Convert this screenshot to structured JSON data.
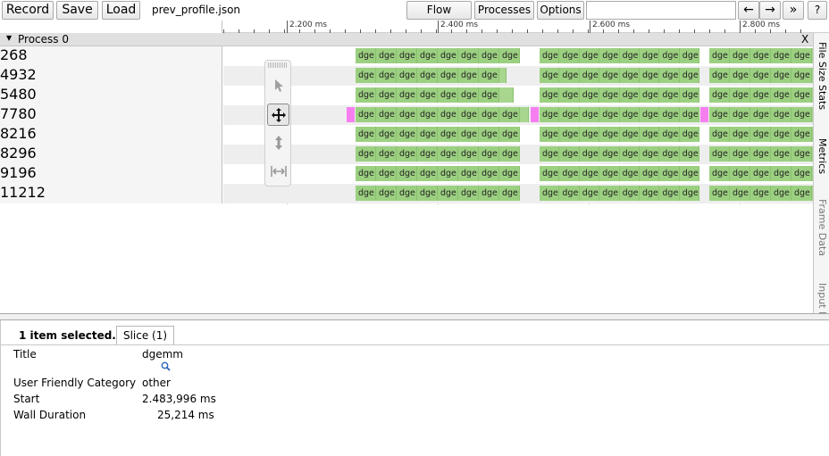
{
  "toolbar": {
    "record_label": "Record",
    "save_label": "Save",
    "load_label": "Load",
    "filename": "prev_profile.json",
    "flow_events_label": "Flow events",
    "processes_label": "Processes",
    "options_label": "Options",
    "search_value": "",
    "prev_label": "←",
    "next_label": "→",
    "forward_all_label": "»",
    "help_label": "?"
  },
  "ruler": {
    "labels": [
      "2.200 ms",
      "2.400 ms",
      "2.600 ms",
      "2.800 ms"
    ]
  },
  "process": {
    "title": "Process 0",
    "close_label": "X"
  },
  "threads": [
    {
      "tid": "268"
    },
    {
      "tid": "4932"
    },
    {
      "tid": "5480"
    },
    {
      "tid": "7780"
    },
    {
      "tid": "8216"
    },
    {
      "tid": "8296"
    },
    {
      "tid": "9196"
    },
    {
      "tid": "11212"
    }
  ],
  "slice_label": "dge",
  "slice_label_clipped": "dge d",
  "side_tabs": [
    "File Size Stats",
    "Metrics",
    "Frame Data",
    "Input L"
  ],
  "analysis": {
    "selection_text": "1 item selected.",
    "tab_label": "Slice (1)",
    "properties": [
      {
        "label": "Title",
        "value": "dgemm"
      },
      {
        "label": "User Friendly Category",
        "value": "other"
      },
      {
        "label": "Start",
        "value": "2.483,996 ms"
      },
      {
        "label": "Wall Duration",
        "value": "25,214 ms"
      }
    ]
  },
  "icons": [
    "pointer-icon",
    "pan-icon",
    "zoom-icon",
    "timing-icon",
    "search-icon",
    "expand-triangle-icon"
  ],
  "colors": {
    "slice_green": "#9cd081",
    "slice_pink": "#f67ff0",
    "process_header": "#e0e0e0"
  }
}
